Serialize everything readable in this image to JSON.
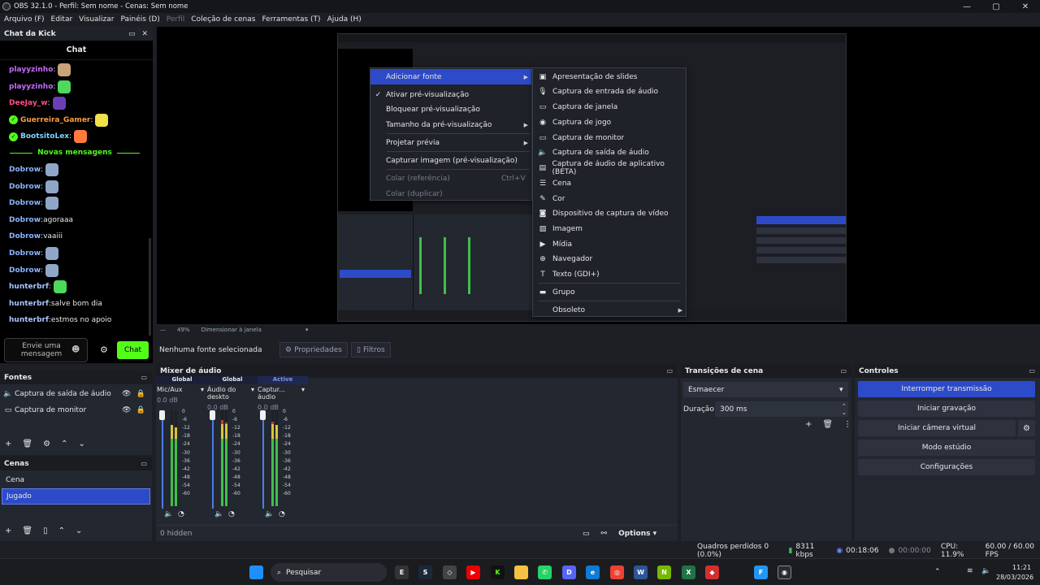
{
  "window": {
    "title": "OBS 32.1.0 - Perfil: Sem nome - Cenas: Sem nome",
    "controls": [
      "—",
      "▢",
      "✕"
    ]
  },
  "menu": [
    {
      "label": "Arquivo (F)",
      "enabled": true
    },
    {
      "label": "Editar",
      "enabled": true
    },
    {
      "label": "Visualizar",
      "enabled": true
    },
    {
      "label": "Painéis (D)",
      "enabled": true
    },
    {
      "label": "Perfil",
      "enabled": false
    },
    {
      "label": "Coleção de cenas",
      "enabled": true
    },
    {
      "label": "Ferramentas (T)",
      "enabled": true
    },
    {
      "label": "Ajuda (H)",
      "enabled": true
    }
  ],
  "chat": {
    "dock_title": "Chat da Kick",
    "header": "Chat",
    "messages": [
      {
        "user": "playyzinho",
        "text": "",
        "color": "#c36bff",
        "badge": false
      },
      {
        "user": "playyzinho",
        "text": "",
        "color": "#c36bff",
        "badge": false
      },
      {
        "user": "DeeJay_w",
        "text": "",
        "color": "#ff4d8a",
        "badge": false
      },
      {
        "user": "Guerreira_Gamer",
        "text": "",
        "color": "#ff9b3d",
        "badge": true
      },
      {
        "user": "BootsitoLex",
        "text": "",
        "color": "#7fd4ff",
        "badge": true
      },
      {
        "user": "Dobrow",
        "text": "",
        "color": "#8ab4ff",
        "badge": false
      },
      {
        "user": "Dobrow",
        "text": "",
        "color": "#8ab4ff",
        "badge": false
      },
      {
        "user": "Dobrow",
        "text": "",
        "color": "#8ab4ff",
        "badge": false
      },
      {
        "user": "Dobrow",
        "text": "agoraaa",
        "color": "#8ab4ff",
        "badge": false
      },
      {
        "user": "Dobrow",
        "text": "vaaiii",
        "color": "#8ab4ff",
        "badge": false
      },
      {
        "user": "Dobrow",
        "text": "",
        "color": "#8ab4ff",
        "badge": false
      },
      {
        "user": "Dobrow",
        "text": "",
        "color": "#8ab4ff",
        "badge": false
      },
      {
        "user": "hunterbrf",
        "text": "",
        "color": "#a9c4ff",
        "badge": false
      },
      {
        "user": "hunterbrf",
        "text": "salve bom dia",
        "color": "#a9c4ff",
        "badge": false
      },
      {
        "user": "hunterbrf",
        "text": "estmos no apoio",
        "color": "#a9c4ff",
        "badge": false
      }
    ],
    "divider": "Novas mensagens",
    "input_placeholder": "Envie uma mensagem",
    "send_label": "Chat",
    "accent": "#53fc18"
  },
  "preview": {
    "zoom": "49%",
    "scale_mode": "Dimensionar à janela"
  },
  "context_menu": {
    "items": [
      {
        "label": "Adicionar fonte",
        "highlight": true,
        "submenu": true
      },
      {
        "label": "Ativar pré-visualização",
        "checked": true
      },
      {
        "label": "Bloquear pré-visualização"
      },
      {
        "label": "Tamanho da pré-visualização",
        "submenu": true
      },
      {
        "label": "Projetar prévia",
        "submenu": true
      },
      {
        "label": "Capturar imagem (pré-visualização)"
      },
      {
        "label": "Colar (referência)",
        "shortcut": "Ctrl+V",
        "disabled": true
      },
      {
        "label": "Colar (duplicar)",
        "disabled": true
      }
    ]
  },
  "submenu": {
    "items": [
      {
        "label": "Apresentação de slides",
        "icon": "slideshow-icon",
        "glyph": "▣"
      },
      {
        "label": "Captura de entrada de áudio",
        "icon": "microphone-icon",
        "glyph": "🎙"
      },
      {
        "label": "Captura de janela",
        "icon": "window-icon",
        "glyph": "▭"
      },
      {
        "label": "Captura de jogo",
        "icon": "gamepad-icon",
        "glyph": "◉"
      },
      {
        "label": "Captura de monitor",
        "icon": "monitor-icon",
        "glyph": "▭"
      },
      {
        "label": "Captura de saída de áudio",
        "icon": "speaker-icon",
        "glyph": "🔈"
      },
      {
        "label": "Captura de áudio de aplicativo (BETA)",
        "icon": "app-audio-icon",
        "glyph": "▤"
      },
      {
        "label": "Cena",
        "icon": "scene-list-icon",
        "glyph": "☰"
      },
      {
        "label": "Cor",
        "icon": "brush-icon",
        "glyph": "✎"
      },
      {
        "label": "Dispositivo de captura de vídeo",
        "icon": "camera-icon",
        "glyph": "◙"
      },
      {
        "label": "Imagem",
        "icon": "image-icon",
        "glyph": "▨"
      },
      {
        "label": "Mídia",
        "icon": "play-icon",
        "glyph": "▶"
      },
      {
        "label": "Navegador",
        "icon": "globe-icon",
        "glyph": "⊕"
      },
      {
        "label": "Texto (GDI+)",
        "icon": "text-icon",
        "glyph": "T"
      },
      {
        "label": "Grupo",
        "icon": "folder-icon",
        "glyph": "▬"
      },
      {
        "label": "Obsoleto",
        "icon": "",
        "glyph": ""
      }
    ]
  },
  "source_bar": {
    "status": "Nenhuma fonte selecionada",
    "properties": "Propriedades",
    "filters": "Filtros"
  },
  "sources": {
    "title": "Fontes",
    "items": [
      {
        "label": "Captura de saída de áudio",
        "icon": "speaker-icon"
      },
      {
        "label": "Captura de monitor",
        "icon": "monitor-icon"
      }
    ]
  },
  "scenes": {
    "title": "Cenas",
    "items": [
      {
        "label": "Cena",
        "selected": false
      },
      {
        "label": "Jugado",
        "selected": true
      }
    ]
  },
  "mixer": {
    "title": "Mixer de áudio",
    "channels": [
      {
        "type": "Global",
        "name": "Mic/Aux",
        "db": "0.0 dB",
        "level": 0.85
      },
      {
        "type": "Global",
        "name": "Áudio do deskto",
        "db": "0.0 dB",
        "level": 0.9
      },
      {
        "type": "Active",
        "name": "Captur... áudio",
        "db": "0.0 dB",
        "level": 0.88
      }
    ],
    "scale": [
      "0",
      "-6",
      "-12",
      "-18",
      "-24",
      "-30",
      "-36",
      "-42",
      "-48",
      "-54",
      "-60"
    ],
    "hidden": "0 hidden",
    "options": "Options"
  },
  "transitions": {
    "title": "Transições de cena",
    "selected": "Esmaecer",
    "duration_label": "Duração",
    "duration_value": "300 ms"
  },
  "controls": {
    "title": "Controles",
    "stop_stream": "Interromper transmissão",
    "start_record": "Iniciar gravação",
    "virtual_cam": "Iniciar câmera virtual",
    "studio_mode": "Modo estúdio",
    "settings": "Configurações"
  },
  "status": {
    "dropped": "Quadros perdidos 0 (0.0%)",
    "bitrate": "8311 kbps",
    "stream_time": "00:18:06",
    "rec_time": "00:00:00",
    "cpu": "CPU: 11.9%",
    "fps": "60.00 / 60.00 FPS"
  },
  "taskbar": {
    "search": "Pesquisar",
    "time": "11:21",
    "date": "28/03/2026"
  }
}
